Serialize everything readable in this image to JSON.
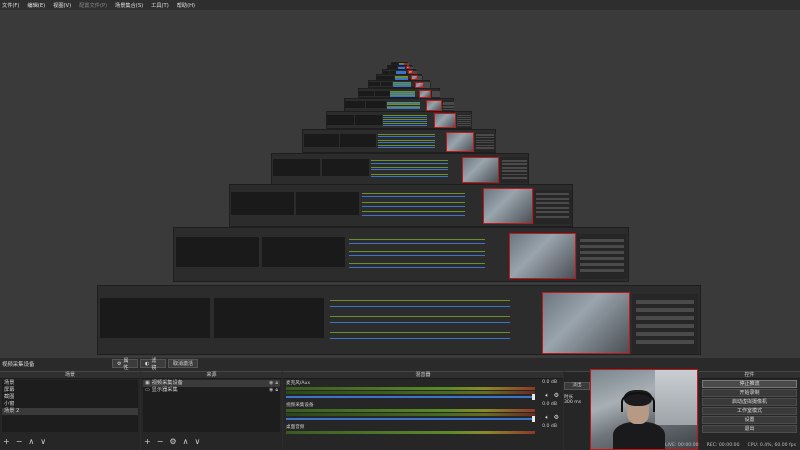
{
  "menu": [
    "文件(F)",
    "编辑(E)",
    "视图(V)",
    "配置文件(P)",
    "场景集合(S)",
    "工具(T)",
    "帮助(H)"
  ],
  "menu_disabled_index": 3,
  "source_bar": {
    "current_source": "视频采集设备",
    "properties_label": "属性",
    "filters_label": "滤镜",
    "deactivate_label": "取消激活"
  },
  "scenes": {
    "title": "场景",
    "items": [
      "场景",
      "屏幕",
      "截图",
      "小窗",
      "场景 2"
    ],
    "selected": 4
  },
  "sources": {
    "title": "来源",
    "items": [
      {
        "label": "视频采集设备",
        "icon": "camera-icon"
      },
      {
        "label": "显示器采集",
        "icon": "monitor-icon"
      }
    ]
  },
  "mixer": {
    "title": "混音器",
    "tracks": [
      {
        "name": "麦克风/Aux",
        "db": "0.0 dB"
      },
      {
        "name": "视频采集设备",
        "db": "0.0 dB"
      },
      {
        "name": "桌面音频",
        "db": "0.0 dB"
      }
    ]
  },
  "transitions": {
    "fade_label": "淡出",
    "duration_label": "时长",
    "duration_value": "300 ms"
  },
  "controls": {
    "title": "控件",
    "buttons": [
      "停止推流",
      "开始录制",
      "启动虚拟摄像机",
      "工作室模式",
      "设置",
      "退出"
    ]
  },
  "status": {
    "live": "LIVE: 00:00:00",
    "rec": "REC: 00:00:00",
    "cpu": "CPU: 0.4%, 60.00 fps"
  },
  "icons": {
    "add": "plus-icon",
    "remove": "minus-icon",
    "up": "chevron-up-icon",
    "down": "chevron-down-icon",
    "gear": "gear-icon",
    "eye": "eye-icon",
    "lock": "lock-icon",
    "speaker": "speaker-icon",
    "settings": "gear-icon"
  },
  "colors": {
    "accent_blue": "#3b73c8",
    "meter_green": "#5b8a2a",
    "preview_border": "#c01818",
    "bg": "#3a3a3a"
  }
}
